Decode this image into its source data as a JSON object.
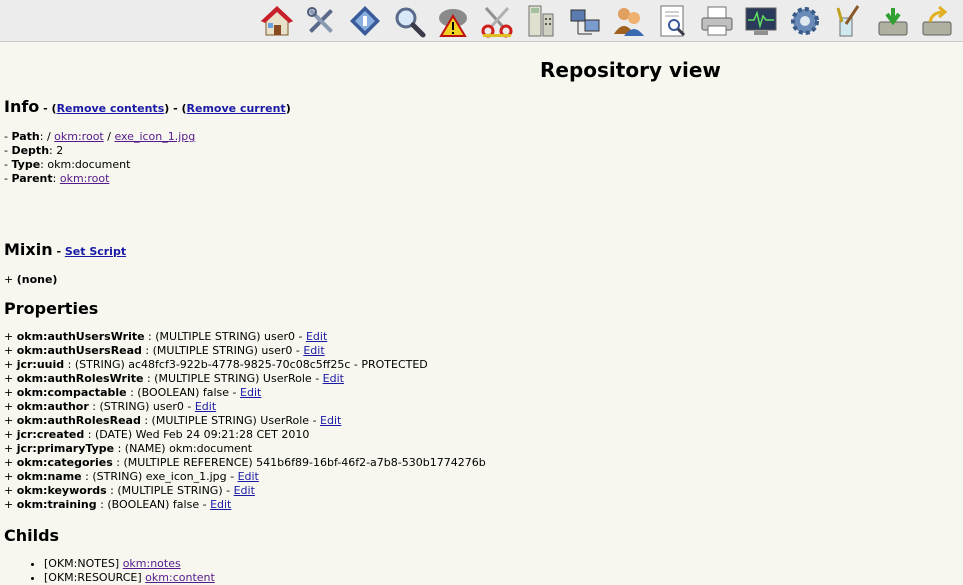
{
  "toolbar": {
    "icons": [
      "home-icon",
      "tools-icon",
      "repository-icon",
      "search-icon",
      "cloud-warning-icon",
      "scissors-icon",
      "calculator-icon",
      "network-icon",
      "users-icon",
      "document-view-icon",
      "printer-icon",
      "monitor-icon",
      "gear-icon",
      "brush-icon",
      "import-icon",
      "export-icon"
    ]
  },
  "page": {
    "title": "Repository view"
  },
  "info": {
    "heading": "Info",
    "dash1": " - (",
    "remove_contents": "Remove contents",
    "mid": ") - (",
    "remove_current": "Remove current",
    "end": ")",
    "path_label": "Path",
    "path_sep": ": / ",
    "path_root": "okm:root",
    "path_sep2": " / ",
    "path_file": "exe_icon_1.jpg",
    "depth_label": "Depth",
    "depth_value": ": 2",
    "type_label": "Type",
    "type_value": ": okm:document",
    "parent_label": "Parent",
    "parent_sep": ": ",
    "parent_value": "okm:root"
  },
  "mixin": {
    "heading": "Mixin",
    "dash": " - ",
    "set_script": "Set Script",
    "item": "(none)"
  },
  "properties": {
    "heading": "Properties",
    "edit_label": "Edit",
    "items": [
      {
        "name": "okm:authUsersWrite",
        "desc": " : (MULTIPLE STRING) user0 - ",
        "edit": true
      },
      {
        "name": "okm:authUsersRead",
        "desc": " : (MULTIPLE STRING) user0 - ",
        "edit": true
      },
      {
        "name": "jcr:uuid",
        "desc": " : (STRING) ac48fcf3-922b-4778-9825-70c08c5ff25c - PROTECTED",
        "edit": false
      },
      {
        "name": "okm:authRolesWrite",
        "desc": " : (MULTIPLE STRING) UserRole - ",
        "edit": true
      },
      {
        "name": "okm:compactable",
        "desc": " : (BOOLEAN) false - ",
        "edit": true
      },
      {
        "name": "okm:author",
        "desc": " : (STRING) user0 - ",
        "edit": true
      },
      {
        "name": "okm:authRolesRead",
        "desc": " : (MULTIPLE STRING) UserRole - ",
        "edit": true
      },
      {
        "name": "jcr:created",
        "desc": " : (DATE) Wed Feb 24 09:21:28 CET 2010",
        "edit": false
      },
      {
        "name": "jcr:primaryType",
        "desc": " : (NAME) okm:document",
        "edit": false
      },
      {
        "name": "okm:categories",
        "desc": " : (MULTIPLE REFERENCE) 541b6f89-16bf-46f2-a7b8-530b1774276b",
        "edit": false
      },
      {
        "name": "okm:name",
        "desc": " : (STRING) exe_icon_1.jpg - ",
        "edit": true
      },
      {
        "name": "okm:keywords",
        "desc": " : (MULTIPLE STRING) - ",
        "edit": true
      },
      {
        "name": "okm:training",
        "desc": " : (BOOLEAN) false - ",
        "edit": true
      }
    ]
  },
  "childs": {
    "heading": "Childs",
    "items": [
      {
        "type": "[OKM:NOTES] ",
        "link": "okm:notes"
      },
      {
        "type": "[OKM:RESOURCE] ",
        "link": "okm:content"
      }
    ]
  }
}
